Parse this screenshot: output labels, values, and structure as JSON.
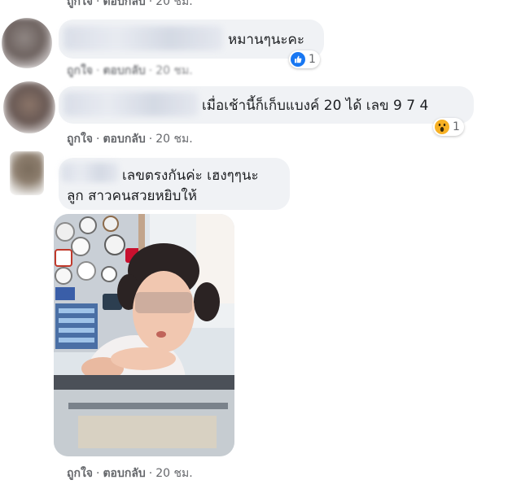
{
  "comments": [
    {
      "text": "หมานๆนะคะ",
      "reaction": {
        "icon": "like-icon",
        "count": "1",
        "color": "#1877f2"
      },
      "actions": {
        "like": "ถูกใจ",
        "reply": "ตอบกลับ",
        "time": "20 ชม."
      }
    },
    {
      "text": "เมื่อเช้านี้ก็เก็บแบงค์ 20 ได้ เลข 9 7 4",
      "reaction": {
        "icon": "wow-icon",
        "count": "1",
        "color": "#f7b125"
      },
      "actions": {
        "like": "ถูกใจ",
        "reply": "ตอบกลับ",
        "time": "20 ชม."
      }
    },
    {
      "text_line1": "เลขตรงกันค่ะ เฮงๆๆนะ",
      "text_line2": "ลูก สาวคนสวยหยิบให้",
      "has_photo": true,
      "actions": {
        "like": "ถูกใจ",
        "reply": "ตอบกลับ",
        "time": "20 ชม."
      }
    }
  ],
  "colors": {
    "bubble": "#f0f2f5",
    "meta_text": "#65676b"
  }
}
